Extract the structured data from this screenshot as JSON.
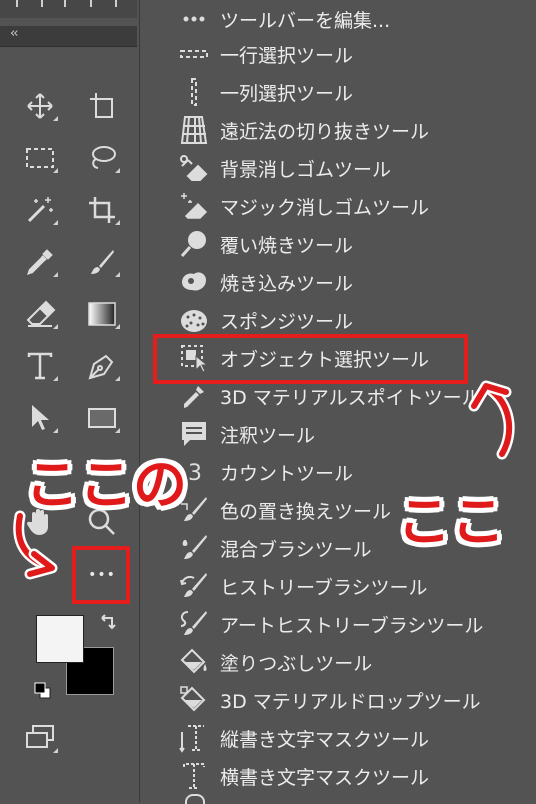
{
  "toolbar": {
    "collapse_label": "‹‹",
    "tools": [
      {
        "name": "move-tool",
        "icon": "move-icon"
      },
      {
        "name": "artboard-tool",
        "icon": "artboard-icon"
      },
      {
        "name": "marquee-tool",
        "icon": "marquee-icon"
      },
      {
        "name": "lasso-tool",
        "icon": "lasso-icon"
      },
      {
        "name": "magic-wand-tool",
        "icon": "magic-wand-icon"
      },
      {
        "name": "crop-tool",
        "icon": "crop-icon"
      },
      {
        "name": "eyedropper-tool",
        "icon": "eyedropper-icon"
      },
      {
        "name": "brush-tool",
        "icon": "brush-icon"
      },
      {
        "name": "eraser-tool",
        "icon": "eraser-icon"
      },
      {
        "name": "gradient-tool",
        "icon": "gradient-icon"
      },
      {
        "name": "type-tool",
        "icon": "type-icon"
      },
      {
        "name": "pen-tool",
        "icon": "pen-icon"
      },
      {
        "name": "path-selection-tool",
        "icon": "arrow-icon"
      },
      {
        "name": "rectangle-tool",
        "icon": "rectangle-icon"
      },
      {
        "name": "hand-tool",
        "icon": "hand-icon"
      },
      {
        "name": "zoom-tool",
        "icon": "zoom-icon"
      }
    ],
    "more_tools_label": "•••",
    "foreground_color": "#f4f4f4",
    "background_color": "#000000"
  },
  "menu": {
    "items": [
      {
        "label": "ツールバーを編集...",
        "icon": "more-dots-icon"
      },
      {
        "label": "一行選択ツール",
        "icon": "single-row-marquee-icon"
      },
      {
        "label": "一列選択ツール",
        "icon": "single-column-marquee-icon"
      },
      {
        "label": "遠近法の切り抜きツール",
        "icon": "perspective-crop-icon"
      },
      {
        "label": "背景消しゴムツール",
        "icon": "background-eraser-icon"
      },
      {
        "label": "マジック消しゴムツール",
        "icon": "magic-eraser-icon"
      },
      {
        "label": "覆い焼きツール",
        "icon": "dodge-icon"
      },
      {
        "label": "焼き込みツール",
        "icon": "burn-icon"
      },
      {
        "label": "スポンジツール",
        "icon": "sponge-icon"
      },
      {
        "label": "オブジェクト選択ツール",
        "icon": "object-selection-icon"
      },
      {
        "label": "3D マテリアルスポイトツール",
        "icon": "3d-eyedropper-icon"
      },
      {
        "label": "注釈ツール",
        "icon": "note-icon"
      },
      {
        "label": "カウントツール",
        "icon": "count-icon"
      },
      {
        "label": "色の置き換えツール",
        "icon": "color-replacement-icon"
      },
      {
        "label": "混合ブラシツール",
        "icon": "mixer-brush-icon"
      },
      {
        "label": "ヒストリーブラシツール",
        "icon": "history-brush-icon"
      },
      {
        "label": "アートヒストリーブラシツール",
        "icon": "art-history-brush-icon"
      },
      {
        "label": "塗りつぶしツール",
        "icon": "paint-bucket-icon"
      },
      {
        "label": "3D マテリアルドロップツール",
        "icon": "3d-material-drop-icon"
      },
      {
        "label": "縦書き文字マスクツール",
        "icon": "vertical-type-mask-icon"
      },
      {
        "label": "横書き文字マスクツール",
        "icon": "horizontal-type-mask-icon"
      }
    ]
  },
  "annotations": {
    "left_callout": "ここの",
    "right_callout": "ここ",
    "color": "#e51d1d"
  }
}
